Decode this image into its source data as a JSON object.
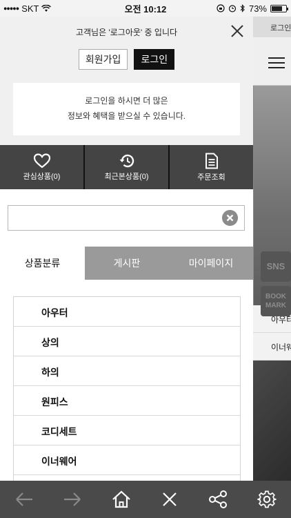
{
  "status_bar": {
    "signal": "●●●●●",
    "carrier": "SKT",
    "time": "오전 10:12",
    "battery_percent": "73%",
    "battery_level": 0.73
  },
  "background_page": {
    "header_text": "로그인",
    "side_buttons": [
      "SNS",
      "BOOK MARK"
    ],
    "category_items": [
      "아우터",
      "이너웨어"
    ]
  },
  "drawer": {
    "logout_message": "고객님은 '로그아웃' 중 입니다",
    "join_label": "회원가입",
    "login_label": "로그인",
    "notice_line1": "로그인을 하시면 더 많은",
    "notice_line2": "정보와 혜택을 받으실 수 있습니다.",
    "quick_menu": [
      {
        "label": "관심상품(0)",
        "icon": "heart-icon"
      },
      {
        "label": "최근본상품(0)",
        "icon": "history-icon"
      },
      {
        "label": "주문조회",
        "icon": "document-icon"
      }
    ],
    "search": {
      "value": "",
      "placeholder": ""
    },
    "tabs": [
      {
        "label": "상품분류",
        "active": true
      },
      {
        "label": "게시판",
        "active": false
      },
      {
        "label": "마이페이지",
        "active": false
      }
    ],
    "categories": [
      "아우터",
      "상의",
      "하의",
      "원피스",
      "코디세트",
      "이너웨어"
    ]
  },
  "toolbar": {
    "buttons": [
      "back-arrow-icon",
      "forward-arrow-icon",
      "home-icon",
      "close-icon",
      "share-icon",
      "settings-gear-icon"
    ]
  },
  "colors": {
    "drawer_top_bg": "#f0f0f0",
    "quick_menu_bg": "#444444",
    "tab_inactive_bg": "#9a9a9a",
    "toolbar_bg": "#4a4a4a",
    "login_button_bg": "#111111"
  }
}
